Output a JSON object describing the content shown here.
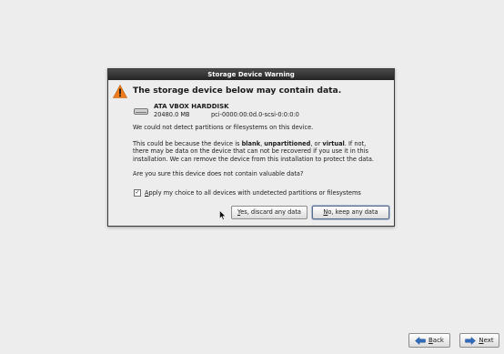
{
  "dialog": {
    "title": "Storage Device Warning",
    "heading": "The storage device below may contain data.",
    "device": {
      "name": "ATA VBOX HARDDISK",
      "size": "20480.0 MB",
      "path": "pci-0000:00:0d.0-scsi-0:0:0:0"
    },
    "message1": "We could not detect partitions or filesystems on this device.",
    "message2_line1_a": "This could be because the device is ",
    "message2_blank": "blank",
    "message2_comma1": ", ",
    "message2_unpartitioned": "unpartitioned",
    "message2_or": ", or ",
    "message2_virtual": "virtual",
    "message2_line1_b": ". If not,",
    "message2_line2": "there may be data on the device that can not be recovered if you use it in this",
    "message2_line3": "installation. We can remove the device from this installation to protect the data.",
    "question": "Are you sure this device does not contain valuable data?",
    "checkbox": {
      "checked": true,
      "mark": "✓",
      "label_mnemonic": "A",
      "label_rest": "pply my choice to all devices with undetected partitions or filesystems"
    },
    "yes_button": {
      "mnemonic": "Y",
      "rest": "es, discard any data"
    },
    "no_button": {
      "mnemonic": "N",
      "rest": "o, keep any data"
    }
  },
  "navigation": {
    "back": {
      "mnemonic": "B",
      "rest": "ack"
    },
    "next": {
      "mnemonic": "N",
      "rest": "ext"
    }
  },
  "colors": {
    "background": "#ededed",
    "titlebar": "#2e2e2e",
    "warning": "#f07c1a",
    "arrow": "#2f6bbd"
  }
}
